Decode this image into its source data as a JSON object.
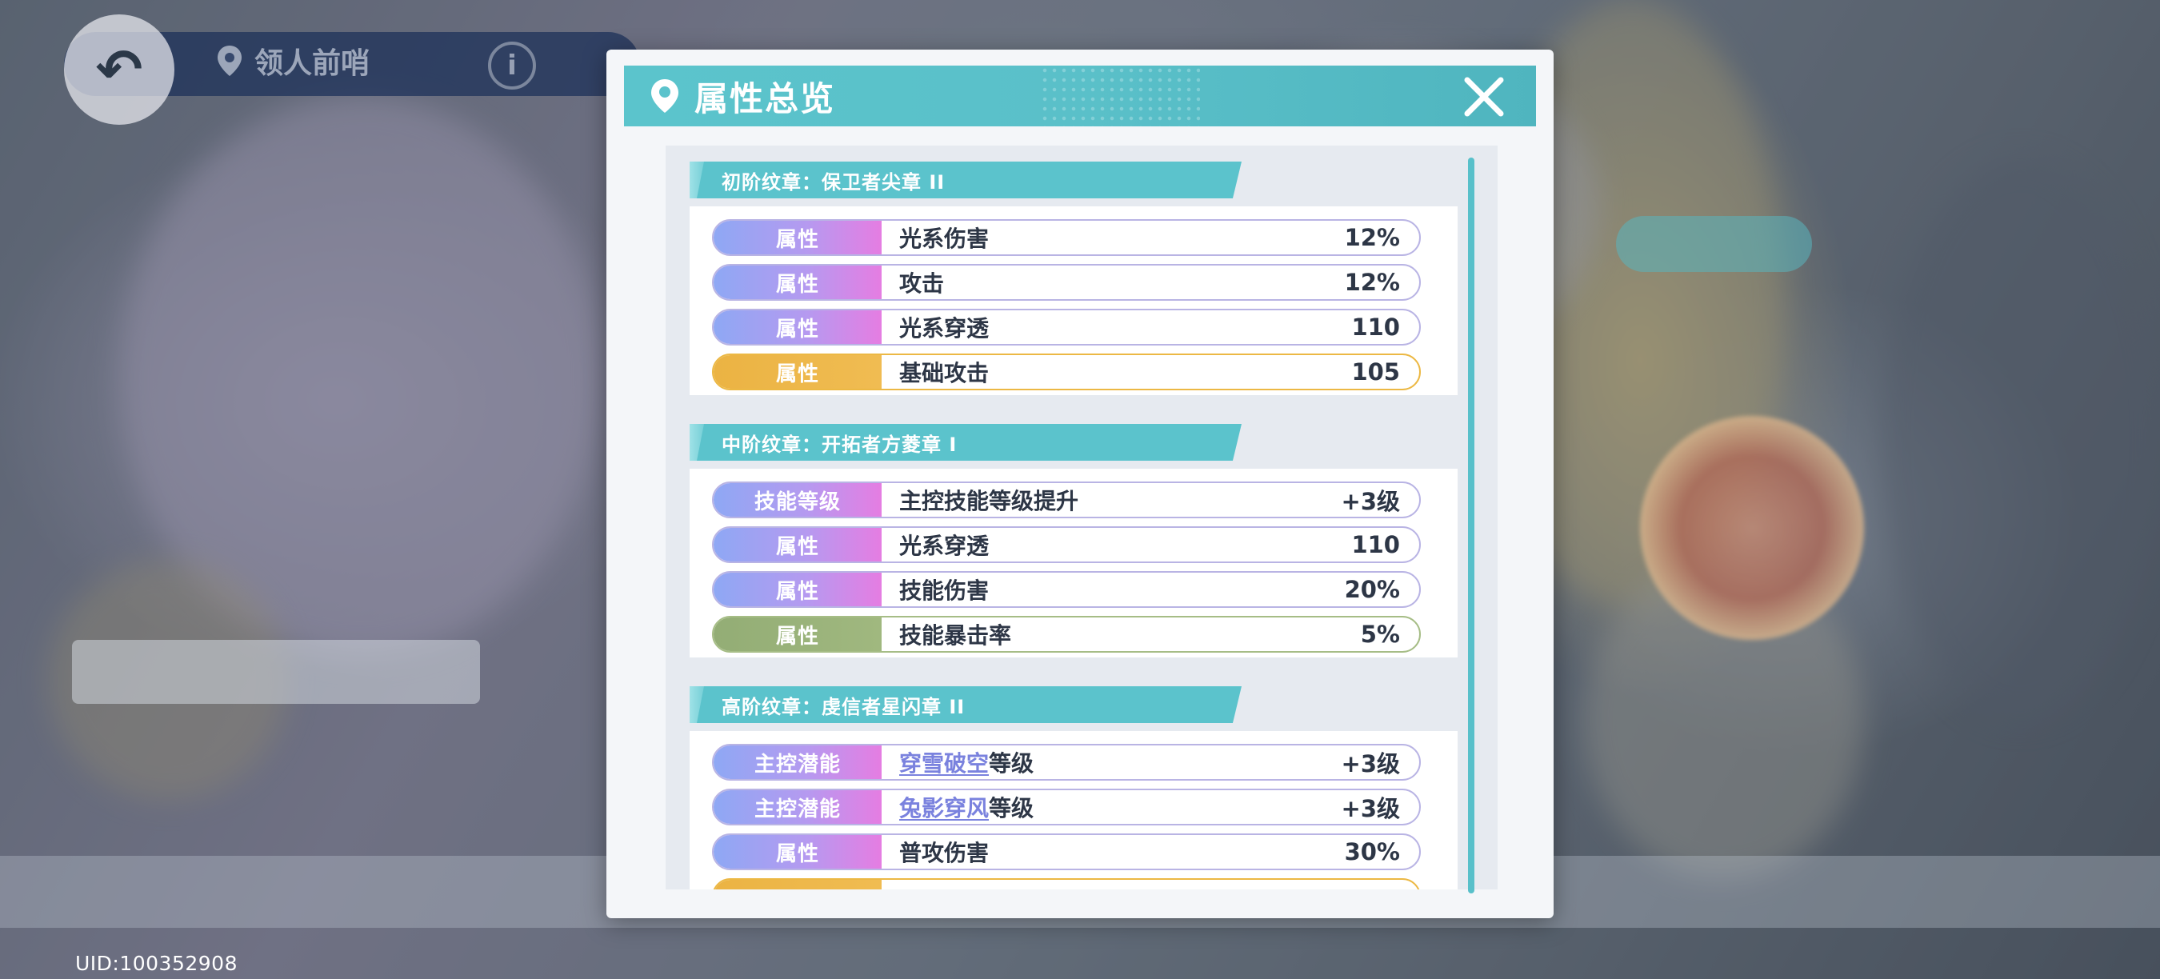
{
  "background": {
    "nav_location": "领人前哨",
    "uid": "UID:100352908"
  },
  "modal": {
    "title": "属性总览",
    "sections": [
      {
        "header": "初阶纹章：保卫者尖章 II",
        "rows": [
          {
            "type": "属性",
            "name": "光系伤害",
            "value": "12%",
            "style": "purple"
          },
          {
            "type": "属性",
            "name": "攻击",
            "value": "12%",
            "style": "purple"
          },
          {
            "type": "属性",
            "name": "光系穿透",
            "value": "110",
            "style": "purple"
          },
          {
            "type": "属性",
            "name": "基础攻击",
            "value": "105",
            "style": "gold"
          }
        ]
      },
      {
        "header": "中阶纹章：开拓者方菱章 I",
        "rows": [
          {
            "type": "技能等级",
            "name": "主控技能等级提升",
            "value": "+3级",
            "style": "purple"
          },
          {
            "type": "属性",
            "name": "光系穿透",
            "value": "110",
            "style": "purple"
          },
          {
            "type": "属性",
            "name": "技能伤害",
            "value": "20%",
            "style": "purple"
          },
          {
            "type": "属性",
            "name": "技能暴击率",
            "value": "5%",
            "style": "green"
          }
        ]
      },
      {
        "header": "高阶纹章：虔信者星闪章 II",
        "rows": [
          {
            "type": "主控潜能",
            "link": "穿雪破空",
            "name": "等级",
            "value": "+3级",
            "style": "purple"
          },
          {
            "type": "主控潜能",
            "link": "兔影穿风",
            "name": "等级",
            "value": "+3级",
            "style": "purple"
          },
          {
            "type": "属性",
            "name": "普攻伤害",
            "value": "30%",
            "style": "purple"
          },
          {
            "type": "",
            "name": "",
            "value": "",
            "style": "gold"
          }
        ]
      }
    ]
  },
  "colors": {
    "accent_teal": "#5bc3cc",
    "row_gradient_purple": "#b59af0",
    "row_gold": "#ebb343",
    "row_green": "#93ad75",
    "link_text": "#7a82de"
  }
}
